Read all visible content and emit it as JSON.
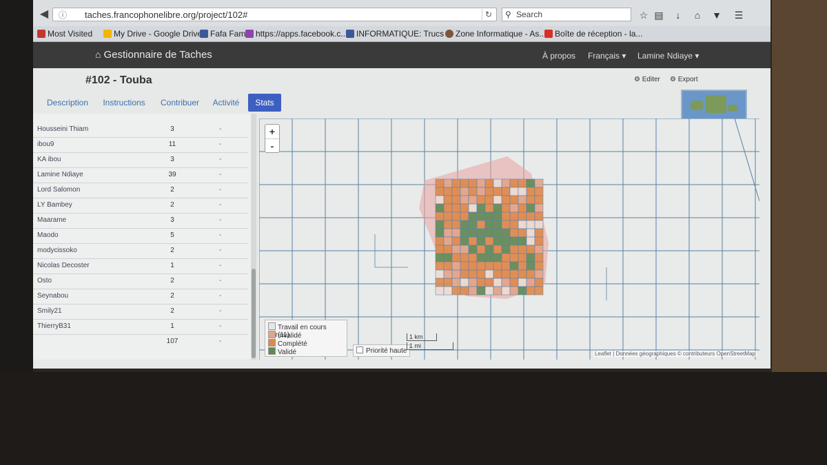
{
  "browser": {
    "url": "taches.francophonelibre.org/project/102#",
    "search_placeholder": "Search",
    "bookmarks": [
      {
        "label": "Most Visited",
        "color": "#c0392b"
      },
      {
        "label": "My Drive - Google Drive",
        "color": "#f4b400"
      },
      {
        "label": "Fafa Fam",
        "color": "#3b5998"
      },
      {
        "label": "https://apps.facebook.c...",
        "color": "#8e44ad"
      },
      {
        "label": "INFORMATIQUE: Trucs ...",
        "color": "#3b5998"
      },
      {
        "label": "Zone Informatique - As...",
        "color": "#7f5539"
      },
      {
        "label": "Boîte de réception - la...",
        "color": "#d93025"
      }
    ]
  },
  "app": {
    "brand": "Gestionnaire de Taches",
    "menu": {
      "about": "À propos",
      "language": "Français",
      "user": "Lamine Ndiaye"
    }
  },
  "project": {
    "title": "#102 - Touba",
    "edit_label": "Editer",
    "export_label": "Export",
    "tabs": [
      "Description",
      "Instructions",
      "Contribuer",
      "Activité",
      "Stats"
    ],
    "active_tab": "Stats"
  },
  "contributors": [
    {
      "name": "Housseini Thiam",
      "count": "3",
      "dash": "-"
    },
    {
      "name": "ibou9",
      "count": "11",
      "dash": "-"
    },
    {
      "name": "KA ibou",
      "count": "3",
      "dash": "-"
    },
    {
      "name": "Lamine Ndiaye",
      "count": "39",
      "dash": "-"
    },
    {
      "name": "Lord Salomon",
      "count": "2",
      "dash": "-"
    },
    {
      "name": "LY Bambey",
      "count": "2",
      "dash": "-"
    },
    {
      "name": "Maarame",
      "count": "3",
      "dash": "-"
    },
    {
      "name": "Maodo",
      "count": "5",
      "dash": "-"
    },
    {
      "name": "modycissoko",
      "count": "2",
      "dash": "-"
    },
    {
      "name": "Nicolas Decoster",
      "count": "1",
      "dash": "-"
    },
    {
      "name": "Osto",
      "count": "2",
      "dash": "-"
    },
    {
      "name": "Seynabou",
      "count": "2",
      "dash": "-"
    },
    {
      "name": "Smily21",
      "count": "2",
      "dash": "-"
    },
    {
      "name": "ThierryB31",
      "count": "1",
      "dash": "-"
    }
  ],
  "total": {
    "count": "107",
    "dash": "-"
  },
  "map": {
    "zoom_in": "+",
    "zoom_out": "-",
    "legend": [
      {
        "label": "Travail en cours sur(11)",
        "color": "#e6e6e6"
      },
      {
        "label": "Invalidé",
        "color": "#e3a58a"
      },
      {
        "label": "Complété",
        "color": "#e0894a"
      },
      {
        "label": "Validé",
        "color": "#5f8a55"
      }
    ],
    "priority_label": "Priorité haute",
    "scale_km": "1 km",
    "scale_mi": "1 mi",
    "attribution": "Leaflet | Données géographiques © contributeurs OpenStreetMap"
  }
}
